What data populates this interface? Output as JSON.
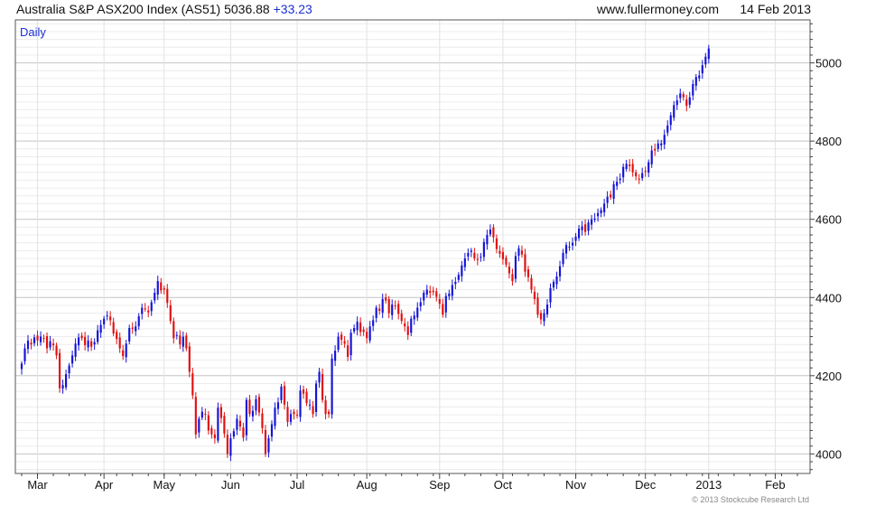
{
  "header": {
    "title": "Australia S&P ASX200 Index (AS51) 5036.88",
    "change": "+33.23",
    "site": "www.fullermoney.com",
    "date": "14 Feb 2013"
  },
  "footer": {
    "copyright": "© 2013 Stockcube Research Ltd"
  },
  "colors": {
    "up": "#1414d8",
    "down": "#e01010",
    "grid": "#cfcfcf",
    "frame": "#555555"
  },
  "chart_data": {
    "type": "candlestick",
    "interval_label": "Daily",
    "y_axis_side": "right",
    "ylim": [
      3950,
      5110
    ],
    "y_ticks": [
      4000,
      4200,
      4400,
      4600,
      4800,
      5000
    ],
    "x_ticks": [
      "Mar",
      "Apr",
      "May",
      "Jun",
      "Jul",
      "Aug",
      "Sep",
      "Oct",
      "Nov",
      "Dec",
      "2013",
      "Feb"
    ],
    "x_tick_trading_day_index": [
      5,
      26,
      45,
      66,
      87,
      109,
      132,
      152,
      175,
      197,
      217,
      238
    ],
    "trading_days": 248,
    "close_series": [
      4231,
      4270,
      4290,
      4280,
      4298,
      4290,
      4300,
      4296,
      4270,
      4288,
      4278,
      4252,
      4168,
      4176,
      4204,
      4226,
      4252,
      4282,
      4298,
      4296,
      4278,
      4290,
      4274,
      4286,
      4316,
      4330,
      4346,
      4354,
      4342,
      4308,
      4294,
      4270,
      4250,
      4282,
      4322,
      4320,
      4326,
      4352,
      4374,
      4372,
      4362,
      4388,
      4412,
      4442,
      4418,
      4420,
      4386,
      4340,
      4296,
      4304,
      4280,
      4300,
      4270,
      4210,
      4150,
      4050,
      4090,
      4108,
      4100,
      4060,
      4050,
      4040,
      4118,
      4092,
      4052,
      4000,
      4040,
      4058,
      4090,
      4070,
      4042,
      4138,
      4102,
      4110,
      4140,
      4106,
      4066,
      4000,
      4040,
      4076,
      4118,
      4132,
      4172,
      4126,
      4082,
      4102,
      4102,
      4100,
      4162,
      4154,
      4130,
      4126,
      4102,
      4180,
      4210,
      4138,
      4102,
      4102,
      4244,
      4264,
      4300,
      4292,
      4282,
      4248,
      4310,
      4322,
      4338,
      4312,
      4312,
      4296,
      4326,
      4342,
      4374,
      4366,
      4396,
      4392,
      4360,
      4382,
      4378,
      4358,
      4340,
      4326,
      4304,
      4346,
      4354,
      4374,
      4388,
      4412,
      4420,
      4412,
      4414,
      4402,
      4384,
      4356,
      4404,
      4410,
      4432,
      4440,
      4458,
      4482,
      4500,
      4514,
      4520,
      4500,
      4496,
      4504,
      4542,
      4560,
      4574,
      4554,
      4524,
      4512,
      4498,
      4484,
      4462,
      4442,
      4506,
      4526,
      4510,
      4466,
      4452,
      4420,
      4396,
      4356,
      4344,
      4360,
      4382,
      4424,
      4440,
      4454,
      4480,
      4514,
      4534,
      4530,
      4540,
      4556,
      4576,
      4582,
      4568,
      4592,
      4600,
      4602,
      4616,
      4624,
      4640,
      4658,
      4656,
      4690,
      4696,
      4704,
      4734,
      4742,
      4736,
      4720,
      4710,
      4704,
      4718,
      4722,
      4746,
      4776,
      4776,
      4794,
      4794,
      4816,
      4840,
      4866,
      4892,
      4904,
      4922,
      4912,
      4890,
      4912,
      4946,
      4964,
      4968,
      4994,
      5016,
      5036.88
    ]
  }
}
